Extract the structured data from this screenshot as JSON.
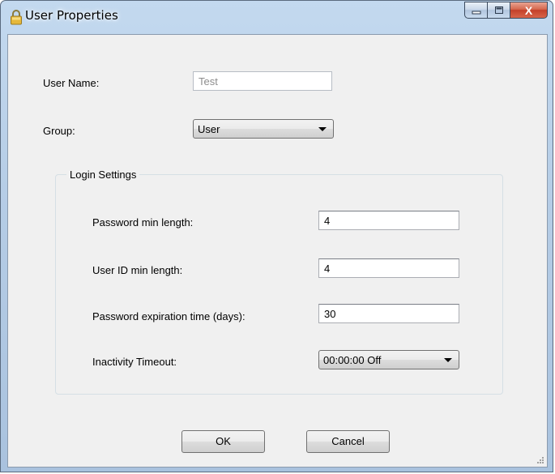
{
  "window": {
    "title": "User Properties",
    "icon": "lock-icon",
    "caption": {
      "close_glyph": "X"
    }
  },
  "form": {
    "user_name_label": "User Name:",
    "user_name_value": "Test",
    "group_label": "Group:",
    "group_value": "User"
  },
  "login_settings": {
    "title": "Login Settings",
    "password_min_length_label": "Password min length:",
    "password_min_length_value": "4",
    "user_id_min_length_label": "User ID min length:",
    "user_id_min_length_value": "4",
    "password_expiration_label": "Password expiration time (days):",
    "password_expiration_value": "30",
    "inactivity_timeout_label": "Inactivity Timeout:",
    "inactivity_timeout_value": "00:00:00 Off"
  },
  "buttons": {
    "ok_label": "OK",
    "cancel_label": "Cancel"
  },
  "colors": {
    "accent_close": "#c4402a",
    "frame": "#b6cde6",
    "client": "#f0f0f0"
  }
}
